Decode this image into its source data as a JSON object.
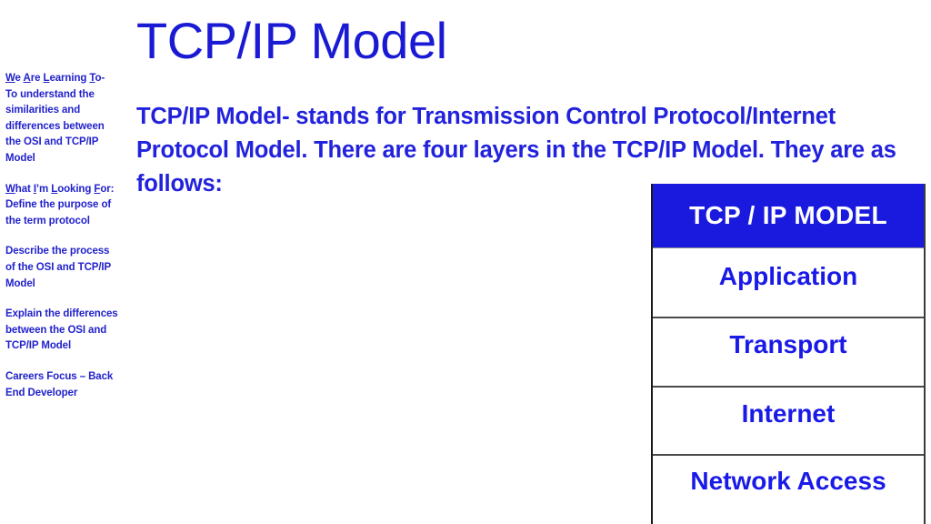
{
  "slide": {
    "title": "TCP/IP Model",
    "body_paragraph": "TCP/IP Model- stands for Transmission Control Protocol/Internet Protocol Model. There are four layers in the TCP/IP Model. They are as follows:"
  },
  "sidebar": {
    "blocks": [
      {
        "heading_html": "<u>W</u>e <u>A</u>re <u>L</u>earning <u>T</u>o-",
        "body": "To understand the similarities and differences between the OSI and TCP/IP Model"
      },
      {
        "heading_html": "<u>W</u>hat <u>I</u>’m <u>L</u>ooking <u>F</u>or:",
        "body": "Define the purpose of the term protocol"
      },
      {
        "heading_html": "",
        "body": "Describe the process of the OSI and TCP/IP Model"
      },
      {
        "heading_html": "",
        "body": "Explain the differences between the OSI and TCP/IP Model"
      },
      {
        "heading_html": "",
        "body": "Careers Focus – Back End Developer"
      }
    ]
  },
  "model_table": {
    "header": "TCP / IP MODEL",
    "layers": [
      "Application",
      "Transport",
      "Internet",
      "Network Access"
    ]
  },
  "colors": {
    "title_blue": "#1A1AD4",
    "body_blue": "#2222DD",
    "sidebar_blue": "#2222CC",
    "header_fill": "#1A1ADF",
    "header_text": "#FFFFFF",
    "layer_text": "#1A1AE8",
    "background": "#FFFFFF",
    "border": "#3A3A3A"
  }
}
